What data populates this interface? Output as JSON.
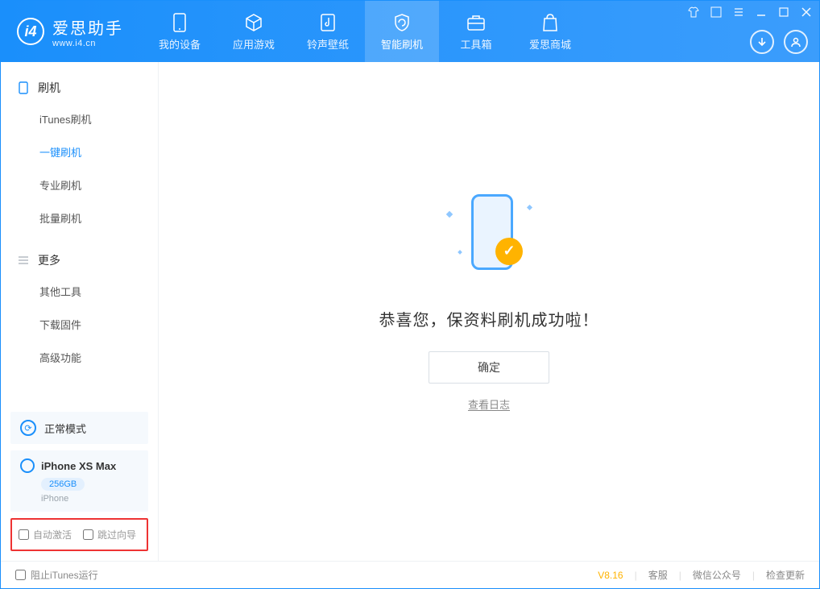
{
  "app": {
    "title": "爱思助手",
    "url": "www.i4.cn"
  },
  "nav": {
    "tabs": [
      {
        "label": "我的设备"
      },
      {
        "label": "应用游戏"
      },
      {
        "label": "铃声壁纸"
      },
      {
        "label": "智能刷机"
      },
      {
        "label": "工具箱"
      },
      {
        "label": "爱思商城"
      }
    ]
  },
  "sidebar": {
    "section1": {
      "title": "刷机",
      "items": [
        "iTunes刷机",
        "一键刷机",
        "专业刷机",
        "批量刷机"
      ]
    },
    "section2": {
      "title": "更多",
      "items": [
        "其他工具",
        "下载固件",
        "高级功能"
      ]
    },
    "mode": "正常模式",
    "device": {
      "name": "iPhone XS Max",
      "storage": "256GB",
      "type": "iPhone"
    },
    "options": {
      "opt1": "自动激活",
      "opt2": "跳过向导"
    }
  },
  "main": {
    "message": "恭喜您，保资料刷机成功啦！",
    "ok": "确定",
    "log": "查看日志"
  },
  "footer": {
    "blockItunes": "阻止iTunes运行",
    "version": "V8.16",
    "links": [
      "客服",
      "微信公众号",
      "检查更新"
    ]
  }
}
